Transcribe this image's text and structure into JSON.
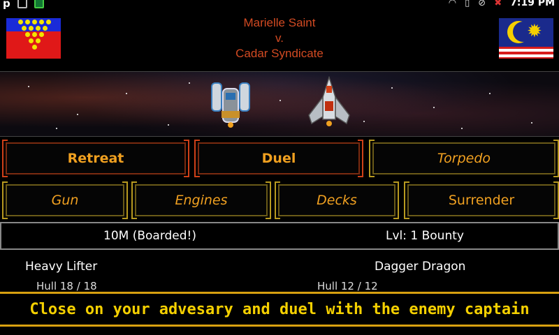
{
  "status_bar": {
    "app_letter": "p",
    "time": "7:19 PM"
  },
  "header": {
    "player_name": "Marielle Saint",
    "versus": "v.",
    "enemy_name": "Cadar Syndicate"
  },
  "actions": {
    "retreat": "Retreat",
    "duel": "Duel",
    "torpedo": "Torpedo",
    "gun": "Gun",
    "engines": "Engines",
    "decks": "Decks",
    "surrender": "Surrender"
  },
  "info": {
    "left": "10M (Boarded!)",
    "right": "Lvl: 1 Bounty"
  },
  "player_ship": {
    "name": "Heavy Lifter",
    "hull": "Hull 18  /  18"
  },
  "enemy_ship": {
    "name": "Dagger Dragon",
    "hull": "Hull 12  /  12"
  },
  "tip": "Close on your advesary and duel with the enemy captain",
  "colors": {
    "accent_orange": "#f0a020",
    "banner_yellow": "#f5d000",
    "name_red": "#d24a22"
  },
  "icons": [
    "app-icon",
    "box-icon",
    "android-icon",
    "wifi-icon",
    "battery-icon",
    "no-signal-icon",
    "alarm-icon"
  ]
}
